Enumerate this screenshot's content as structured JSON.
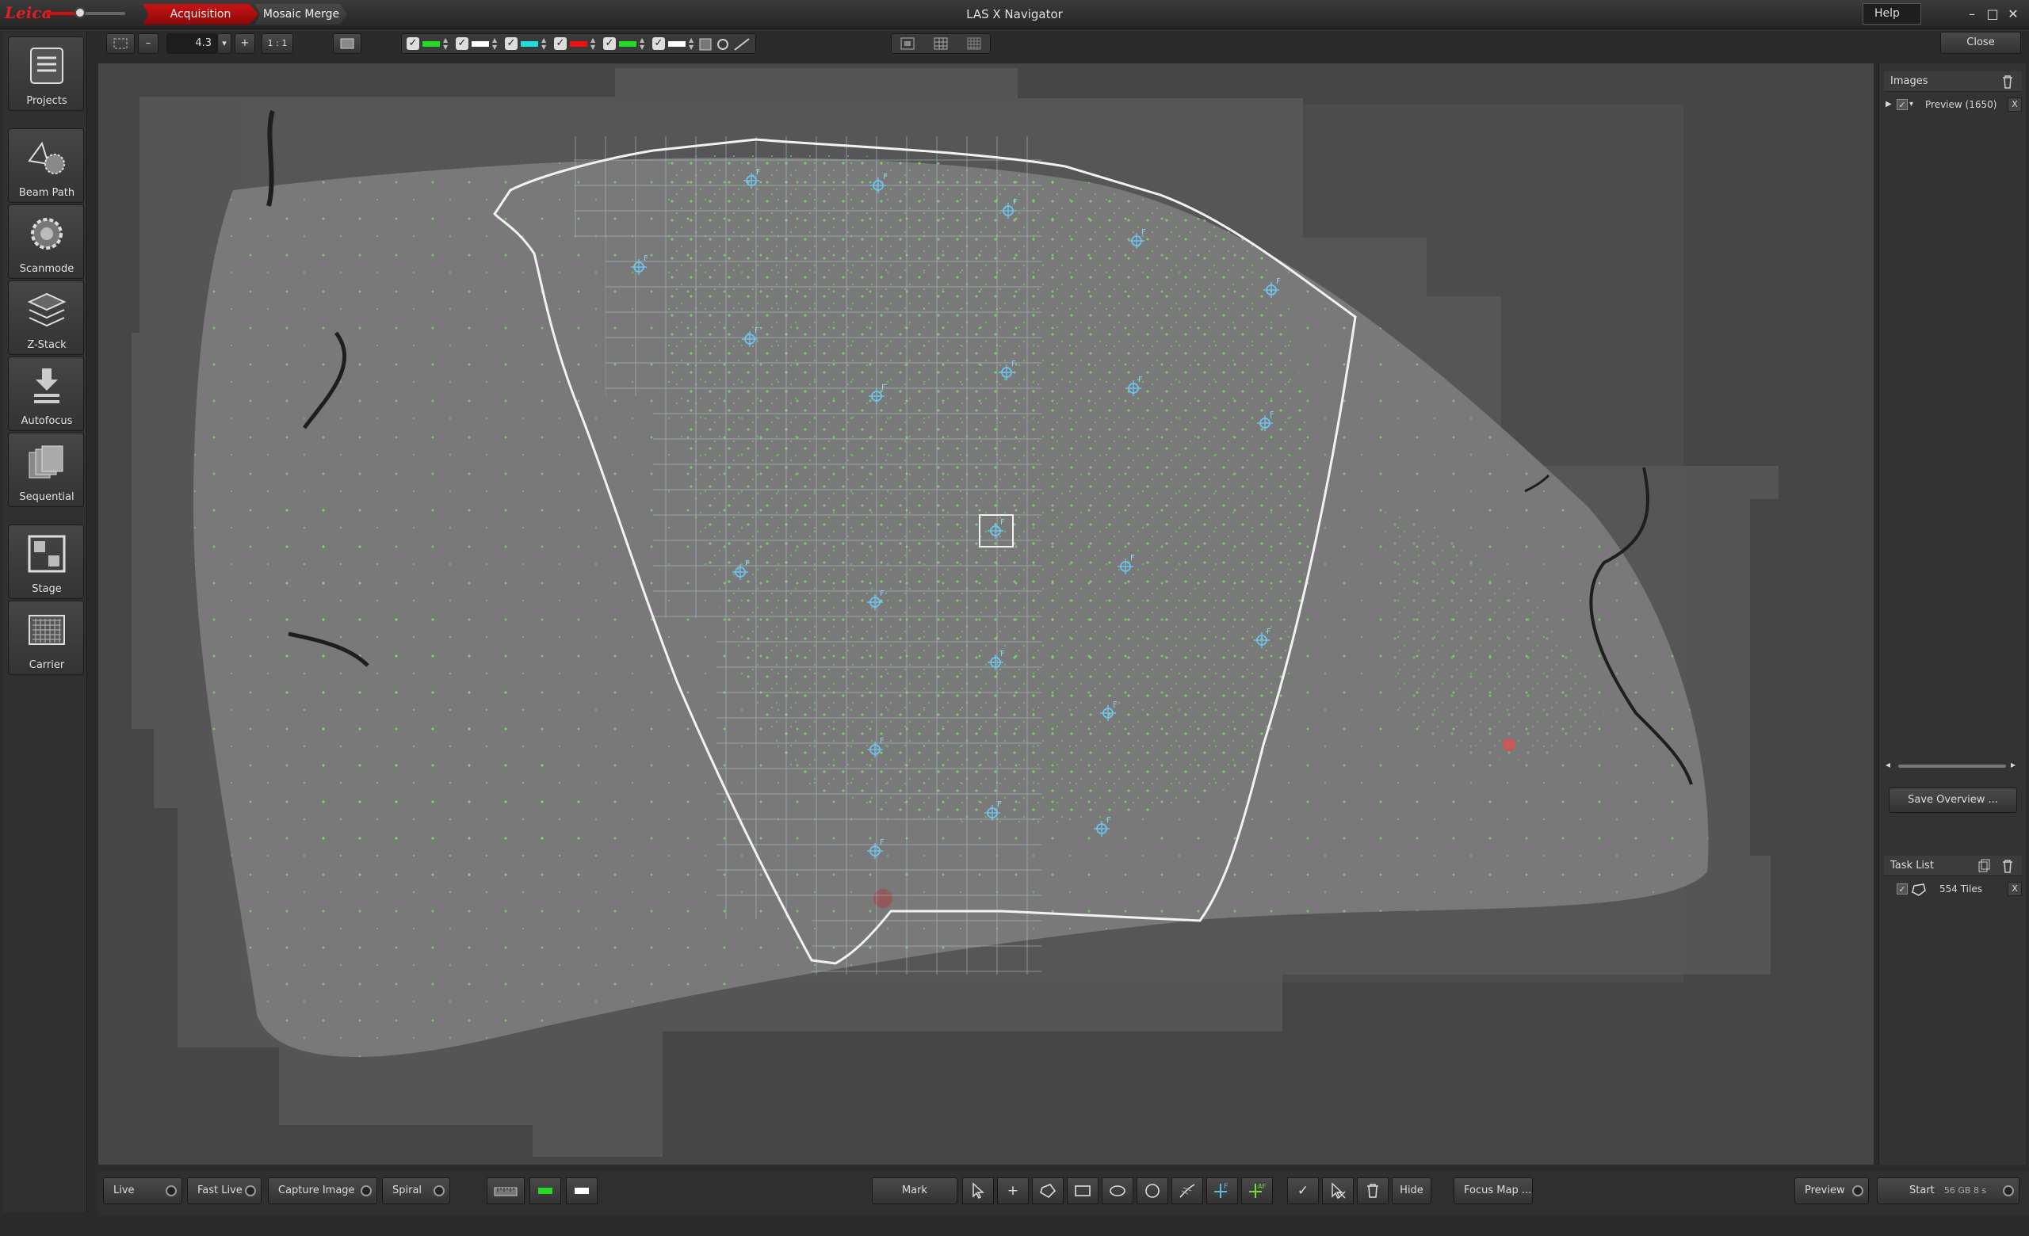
{
  "titlebar": {
    "logo": "Leica",
    "tabs": [
      {
        "label": "Acquisition"
      },
      {
        "label": "Mosaic Merge"
      }
    ],
    "title": "LAS X Navigator",
    "help": "Help",
    "controls": {
      "minimize": "–",
      "maximize": "□",
      "close": "✕"
    }
  },
  "toolbar": {
    "zoom_value": "4.3",
    "zoom_minus": "–",
    "zoom_plus": "+",
    "zoom_dropdown": "▾",
    "one_to_one": "1 : 1",
    "close": "Close",
    "channels": [
      {
        "color": "#22dd22"
      },
      {
        "color": "#ffffff"
      },
      {
        "color": "#22dddd"
      },
      {
        "color": "#ee1111"
      },
      {
        "color": "#22dd22"
      },
      {
        "color": "#ffffff"
      }
    ]
  },
  "sidebar": {
    "items": [
      {
        "label": "Projects",
        "icon": "projects-icon"
      },
      {
        "label": "Beam Path",
        "icon": "beam-path-icon"
      },
      {
        "label": "Scanmode",
        "icon": "scanmode-icon"
      },
      {
        "label": "Z-Stack",
        "icon": "z-stack-icon"
      },
      {
        "label": "Autofocus",
        "icon": "autofocus-icon"
      },
      {
        "label": "Sequential",
        "icon": "sequential-icon"
      },
      {
        "label": "Stage",
        "icon": "stage-icon"
      },
      {
        "label": "Carrier",
        "icon": "carrier-icon"
      }
    ]
  },
  "right_panel": {
    "images_header": "Images",
    "images_items": [
      {
        "label": "Preview (1650)"
      }
    ],
    "remove": "X",
    "save_overview": "Save Overview ...",
    "task_list_header": "Task List",
    "task_items": [
      {
        "label": "554 Tiles"
      }
    ]
  },
  "bottombar": {
    "live": "Live",
    "fast_live": "Fast Live",
    "capture_image": "Capture Image",
    "spiral": "Spiral",
    "mark": "Mark",
    "hide": "Hide",
    "focus_map": "Focus Map ...",
    "preview": "Preview",
    "start": "Start",
    "start_info": "56 GB  8 s",
    "tool_glyphs": {
      "plus": "+",
      "check": "✓"
    }
  },
  "canvas": {
    "focus_marker_label": "F"
  }
}
